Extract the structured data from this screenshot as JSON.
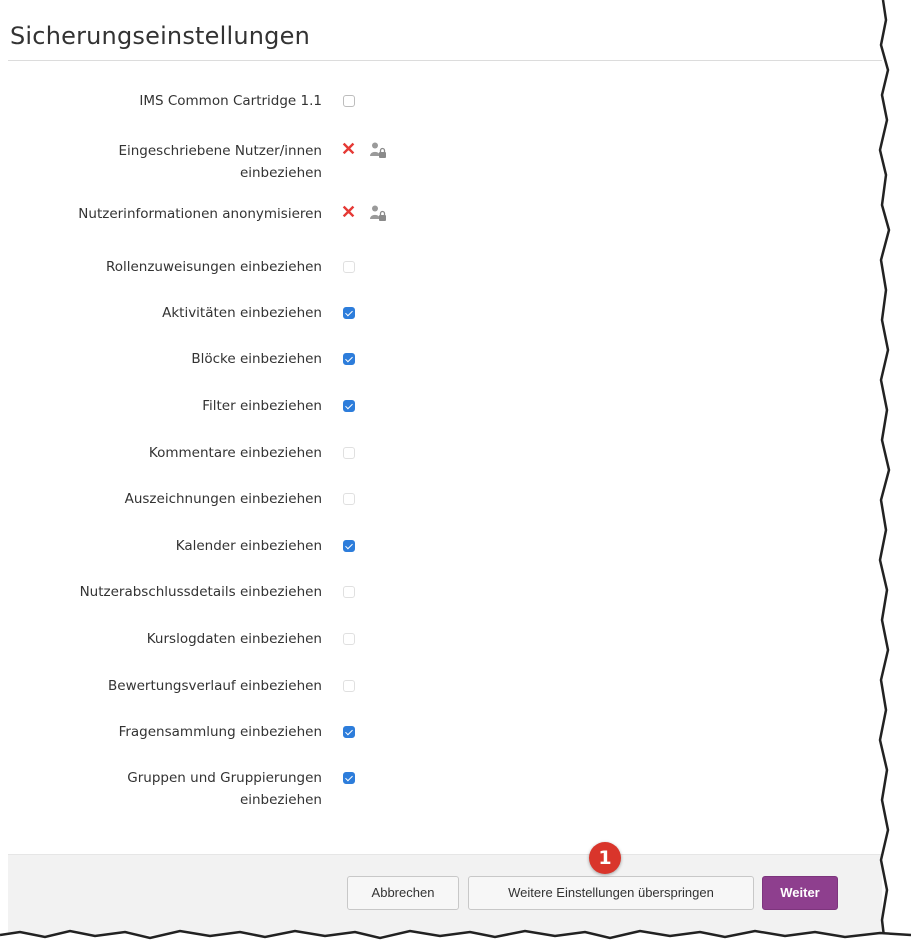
{
  "title": "Sicherungseinstellungen",
  "settings": [
    {
      "label": "IMS Common Cartridge 1.1",
      "state": "unchecked"
    },
    {
      "label": "Eingeschriebene Nutzer/innen einbeziehen",
      "state": "locked"
    },
    {
      "label": "Nutzerinformationen anonymisieren",
      "state": "locked"
    },
    {
      "label": "Rollenzuweisungen einbeziehen",
      "state": "disabled"
    },
    {
      "label": "Aktivitäten einbeziehen",
      "state": "checked"
    },
    {
      "label": "Blöcke einbeziehen",
      "state": "checked"
    },
    {
      "label": "Filter einbeziehen",
      "state": "checked"
    },
    {
      "label": "Kommentare einbeziehen",
      "state": "disabled"
    },
    {
      "label": "Auszeichnungen einbeziehen",
      "state": "disabled"
    },
    {
      "label": "Kalender einbeziehen",
      "state": "checked"
    },
    {
      "label": "Nutzerabschlussdetails einbeziehen",
      "state": "disabled"
    },
    {
      "label": "Kurslogdaten einbeziehen",
      "state": "disabled"
    },
    {
      "label": "Bewertungsverlauf einbeziehen",
      "state": "disabled"
    },
    {
      "label": "Fragensammlung einbeziehen",
      "state": "checked"
    },
    {
      "label": "Gruppen und Gruppierungen einbeziehen",
      "state": "checked"
    }
  ],
  "footer": {
    "cancel_label": "Abbrechen",
    "skip_label": "Weitere Einstellungen überspringen",
    "next_label": "Weiter"
  },
  "annotation_badge": "1",
  "colors": {
    "accent": "#8e3f8e",
    "checkbox_checked": "#2d7ddb",
    "cross": "#e53935",
    "badge": "#d9352b"
  }
}
